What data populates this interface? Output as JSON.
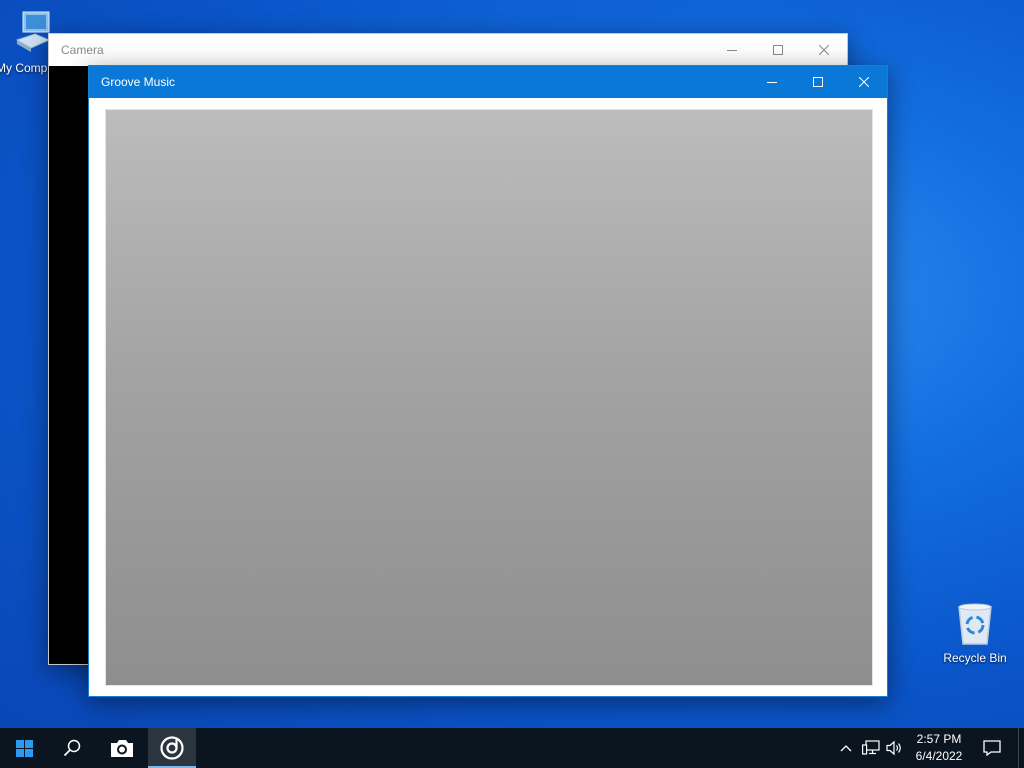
{
  "desktop": {
    "icons": [
      {
        "label": "My Computer",
        "icon": "computer-icon"
      },
      {
        "label": "Recycle Bin",
        "icon": "recycle-bin-icon"
      }
    ]
  },
  "windows": {
    "camera": {
      "title": "Camera"
    },
    "groove": {
      "title": "Groove Music"
    }
  },
  "taskbar": {
    "start": "windows-logo-icon",
    "search": "search-icon",
    "apps": [
      {
        "name": "Camera",
        "icon": "camera-icon",
        "active": false
      },
      {
        "name": "Groove Music",
        "icon": "groove-music-icon",
        "active": true
      }
    ],
    "tray": [
      "chevron-up-icon",
      "network-icon",
      "volume-icon"
    ],
    "clock": {
      "time": "2:57 PM",
      "date": "6/4/2022"
    },
    "notifications": "action-center-icon"
  },
  "colors": {
    "desktop_bg": "#0a55c9",
    "groove_titlebar": "#0a78d7",
    "camera_titlebar": "#ffffff",
    "taskbar": "#0a1520"
  }
}
